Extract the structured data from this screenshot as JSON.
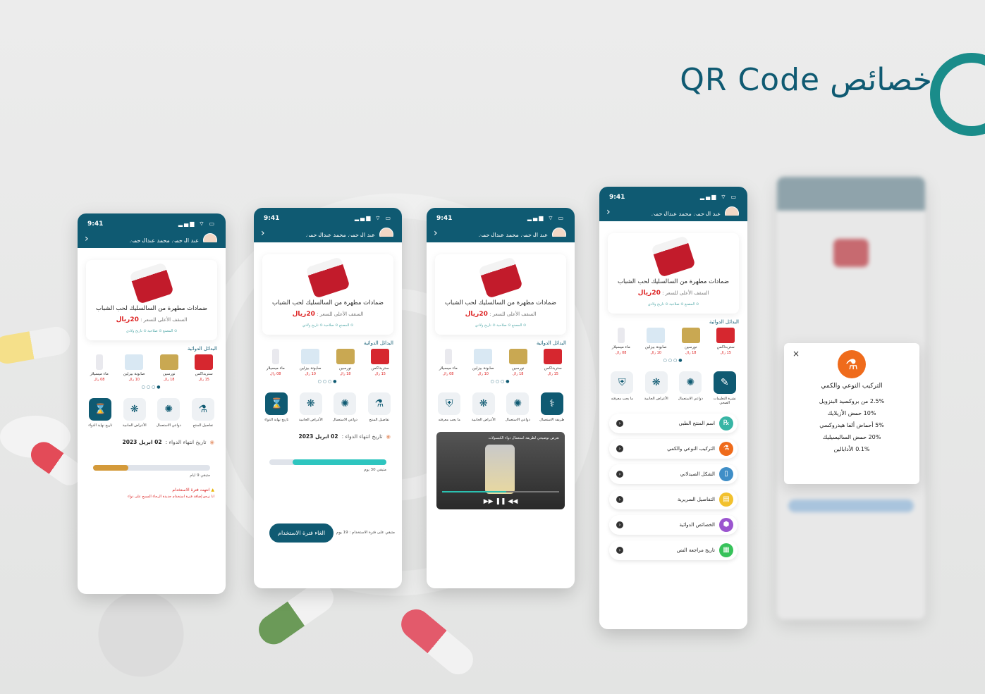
{
  "page": {
    "title": "خصائص QR Code"
  },
  "phone": {
    "time": "9:41",
    "status_icons": "▂▄▆ ⌔ ▭",
    "user_name": "عبد الرحمن محمد عبدالرحمن",
    "back": "‹"
  },
  "product": {
    "name": "ضمادات مطهرة من السالسليك لحب الشباب",
    "price_label": "السقف الأعلى للسعر :",
    "price_value": "20ريال",
    "tags": "⊙ المصنع   ⊙ صلاحية   ⊙ تاريخ ولادي"
  },
  "alternatives": {
    "section_title": "البدائل الدوائية",
    "items": [
      {
        "name": "ستربداكس",
        "price": "15 رال"
      },
      {
        "name": "نورسين",
        "price": "18 رال"
      },
      {
        "name": "صابونة بيزلين",
        "price": "10 رال"
      },
      {
        "name": "ماء ميسيلار",
        "price": "08 رال"
      }
    ],
    "dots": "●○○○"
  },
  "tabs": [
    {
      "label": "تفاصيل المنتج",
      "icon": "⚗"
    },
    {
      "label": "دواعي الاستعمال",
      "icon": "✺"
    },
    {
      "label": "الأعراض الجانبية",
      "icon": "❋"
    },
    {
      "label": "تاريخ نهاية الدواء",
      "icon": "⌛"
    }
  ],
  "tabs_p3": [
    {
      "label": "طريقة الاستعمال",
      "icon": "⚕"
    },
    {
      "label": "دواعي الاستعمال",
      "icon": "✺"
    },
    {
      "label": "الأعراض الجانبية",
      "icon": "❋"
    },
    {
      "label": "ما يجب معرفته",
      "icon": "⛨"
    }
  ],
  "tabs_p4": [
    {
      "label": "نشرة التعليمات الصحي",
      "icon": "✎"
    },
    {
      "label": "دواعي الاستعمال",
      "icon": "✺"
    },
    {
      "label": "الأعراض الجانبية",
      "icon": "❋"
    },
    {
      "label": "ما يجب معرفته",
      "icon": "⛨"
    }
  ],
  "expiry": {
    "label": "تاريخ انتهاء الدواء :",
    "date": "02 ابريل 2023",
    "remaining_p1": "متبقي 9 ايام",
    "remaining_p2": "متبقي 30 يوم",
    "warning_title": "انتهت فترة الاستخدام",
    "warning_text": "انا نرجو إضافة فترة استخدام جديدة الرجاء المسح على دواء",
    "usage_period": "متبقي على فترة الاستخدام : 19 يوم",
    "progress_p1": 0.3,
    "progress_p2": 0.8
  },
  "cancel_button": "الغاء فترة الاستخدام",
  "video": {
    "caption": "تعرض توضيحي لطريقة استعمال دواء الكبسولات"
  },
  "properties": [
    {
      "label": "اسم المنتج الطبي",
      "color": "#38b5a5",
      "icon": "℞"
    },
    {
      "label": "التركيب النوعي والكمي",
      "color": "#ef6b1b",
      "icon": "⚗"
    },
    {
      "label": "الشكل الصيدلاني",
      "color": "#3f8ec7",
      "icon": "▯"
    },
    {
      "label": "التفاصيل السريرية",
      "color": "#f2c12e",
      "icon": "▤"
    },
    {
      "label": "الخصائص الدوائية",
      "color": "#9b55cf",
      "icon": "⬢"
    },
    {
      "label": "تاريخ مراجعة النص",
      "color": "#37c25a",
      "icon": "▦"
    }
  ],
  "modal": {
    "title": "التركيب النوعي والكمي",
    "close": "×",
    "rows": [
      "2.5% من بروكسيد البنزويل",
      "10% حمض الأزيلايك",
      "5% أحماض ألفا هيدروكسي",
      "20% حمض الساليسيليك",
      "0.1% الأدابالين"
    ]
  }
}
